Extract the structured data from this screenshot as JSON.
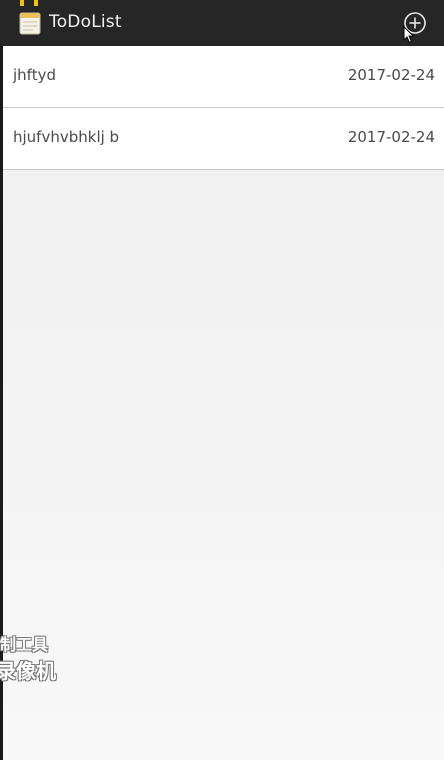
{
  "app": {
    "title": "ToDoList",
    "icon": "notepad-icon",
    "accent_color": "#262626"
  },
  "toolbar": {
    "add_icon": "add-circle-icon"
  },
  "todos": [
    {
      "title": "jhftyd",
      "date": "2017-02-24"
    },
    {
      "title": "hjufvhvbhklj b",
      "date": "2017-02-24"
    }
  ],
  "watermark": {
    "line1": "制工具",
    "line2": "录像机"
  }
}
